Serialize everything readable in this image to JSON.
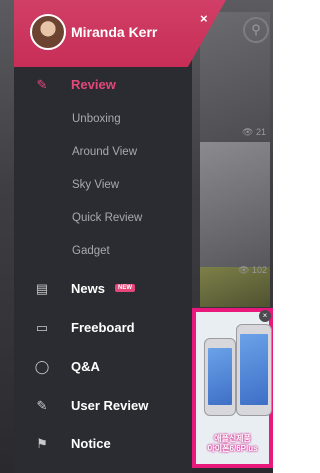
{
  "user": {
    "name": "Miranda Kerr"
  },
  "menu": {
    "review": "Review",
    "sub_items": [
      "Unboxing",
      "Around View",
      "Sky View",
      "Quick Review",
      "Gadget"
    ],
    "news": "News",
    "news_badge": "NEW",
    "freeboard": "Freeboard",
    "qa": "Q&A",
    "user_review": "User Review",
    "notice": "Notice"
  },
  "background": {
    "views_1": "21",
    "views_2": "102"
  },
  "ad": {
    "line1": "애플신제품",
    "line2": "아이폰6/6Plus"
  },
  "colors": {
    "accent": "#e4477a",
    "header": "#d13f66",
    "drawer": "#2b2c31",
    "ad_border": "#e8197a"
  }
}
